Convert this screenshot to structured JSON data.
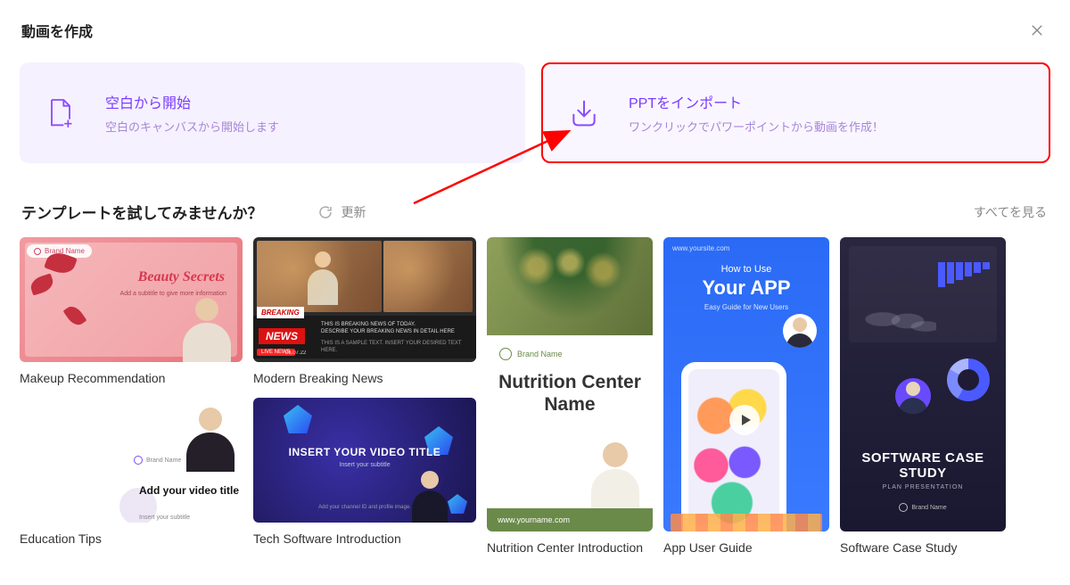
{
  "header": {
    "title": "動画を作成"
  },
  "options": {
    "blank": {
      "title": "空白から開始",
      "desc": "空白のキャンバスから開始します"
    },
    "ppt": {
      "title": "PPTをインポート",
      "desc": "ワンクリックでパワーポイントから動画を作成！"
    }
  },
  "section": {
    "title": "テンプレートを試してみませんか？",
    "refresh": "更新",
    "see_all": "すべてを見る"
  },
  "templates": {
    "a": {
      "title": "Makeup Recommendation",
      "brand": "Brand Name",
      "headline": "Beauty Secrets",
      "sub": "Add a subtitle to give more information"
    },
    "b": {
      "title": "Modern Breaking News",
      "breaking": "BREAKING",
      "news": "NEWS",
      "ticker1": "THIS IS BREAKING NEWS OF TODAY.",
      "ticker2": "DESCRIBE YOUR BREAKING NEWS IN DETAIL HERE",
      "ticker3": "THIS IS A SAMPLE TEXT. INSERT YOUR DESIRED TEXT HERE.",
      "live": "LIVE NEWS",
      "date": "26.07.22"
    },
    "c": {
      "title": "Education Tips",
      "brand": "Brand Name",
      "headline": "Add your video title",
      "sub": "Insert your subtitle"
    },
    "d": {
      "title": "Tech Software Introduction",
      "line1": "INSERT YOUR VIDEO TITLE",
      "line2": "Insert your subtitle",
      "line3": "Add your channel ID and profile image."
    },
    "e": {
      "title": "Nutrition Center Introduction",
      "brand": "Brand Name",
      "headline": "Nutrition Center Name",
      "url": "www.yourname.com"
    },
    "f": {
      "title": "App User Guide",
      "url": "www.yoursite.com",
      "line1": "How to Use",
      "line2": "Your APP",
      "line3": "Easy Guide for New Users"
    },
    "g": {
      "title": "Software Case Study",
      "line1": "SOFTWARE CASE STUDY",
      "line2": "PLAN PRESENTATION",
      "brand": "Brand Name"
    }
  }
}
